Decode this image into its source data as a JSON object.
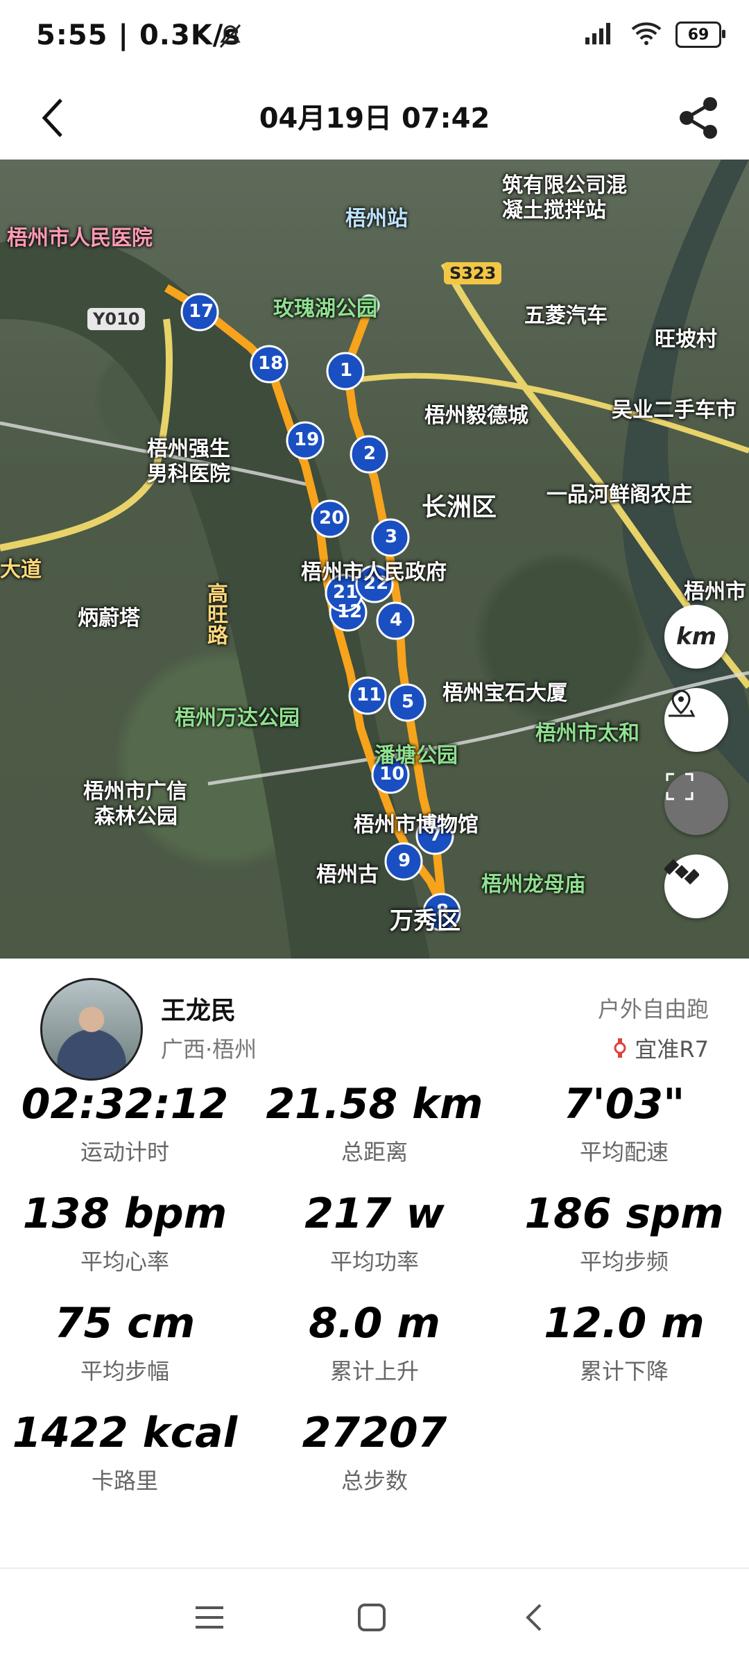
{
  "status_bar": {
    "time": "5:55 | 0.3K/s",
    "battery": "69",
    "icons": [
      "mute-icon",
      "signal-icon",
      "wifi-icon",
      "battery-icon"
    ]
  },
  "header": {
    "title": "04月19日 07:42",
    "icons": [
      "back-icon",
      "share-icon"
    ]
  },
  "map": {
    "labels": [
      "梧州市人民医院",
      "梧州站",
      "玫瑰湖公园",
      "五菱汽车",
      "旺坡村",
      "梧州毅德城",
      "吴业二手车市",
      "梧州强生",
      "男科医院",
      "长洲区",
      "一品河鲜阁农庄",
      "梧州市人民政府",
      "梧州市",
      "炳蔚塔",
      "梧州宝石大厦",
      "梧州市太和",
      "梧州万达公园",
      "潘塘公园",
      "梧州市广信",
      "森林公园",
      "梧州市博物馆",
      "梧州龙母庙",
      "梧州古",
      "万秀区",
      "筑有限公司混",
      "凝土搅拌站",
      "大道",
      "高旺路"
    ],
    "road_signs": [
      "Y010",
      "S323"
    ],
    "markers": [
      "1",
      "2",
      "3",
      "4",
      "5",
      "7",
      "8",
      "9",
      "10",
      "11",
      "12",
      "17",
      "18",
      "19",
      "20",
      "21",
      "22"
    ],
    "buttons": {
      "km": "km"
    },
    "button_icons": [
      "location-pin-icon",
      "fullscreen-icon",
      "satellite-icon"
    ]
  },
  "profile": {
    "name": "王龙民",
    "location": "广西·梧州",
    "sport_type": "户外自由跑",
    "device": "宜准R7"
  },
  "stats": [
    {
      "value": "02:32:12",
      "label": "运动计时"
    },
    {
      "value": "21.58 km",
      "label": "总距离"
    },
    {
      "value": "7'03\"",
      "label": "平均配速"
    },
    {
      "value": "138 bpm",
      "label": "平均心率"
    },
    {
      "value": "217 w",
      "label": "平均功率"
    },
    {
      "value": "186 spm",
      "label": "平均步频"
    },
    {
      "value": "75 cm",
      "label": "平均步幅"
    },
    {
      "value": "8.0 m",
      "label": "累计上升"
    },
    {
      "value": "12.0 m",
      "label": "累计下降"
    },
    {
      "value": "1422 kcal",
      "label": "卡路里"
    },
    {
      "value": "27207",
      "label": "总步数"
    }
  ],
  "nav_bar": {
    "icons": [
      "menu-icon",
      "home-icon",
      "back-nav-icon"
    ]
  }
}
